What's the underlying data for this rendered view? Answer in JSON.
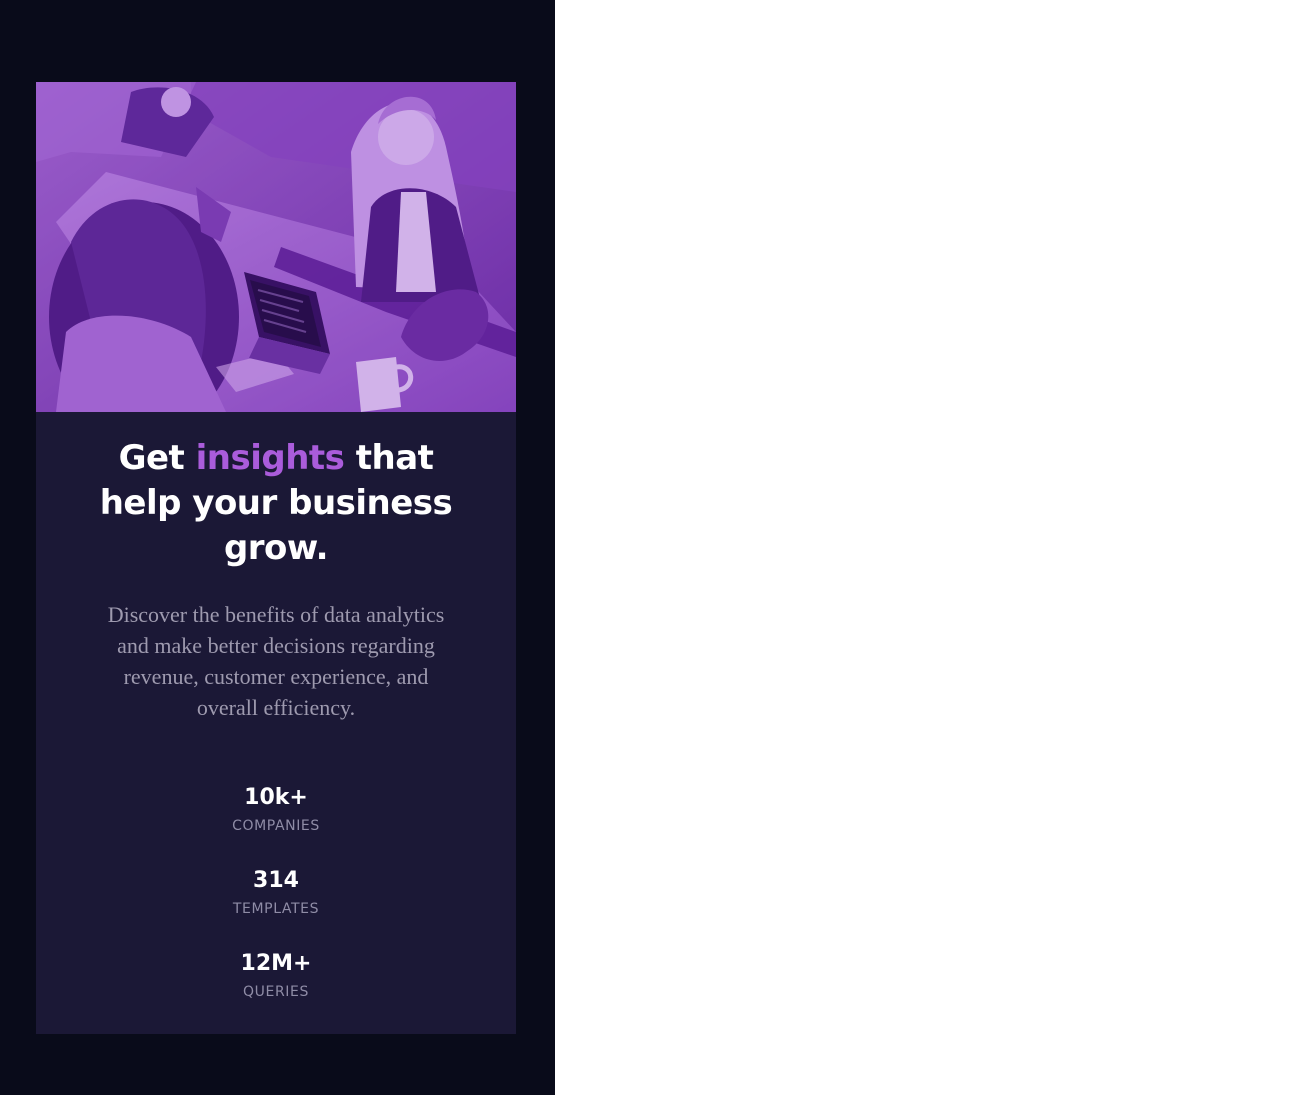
{
  "hero": {
    "image": "office-team-at-laptops-photo"
  },
  "heading": {
    "before": "Get ",
    "accent": "insights",
    "after": " that help your business grow."
  },
  "description": "Discover the benefits of data analytics and make better decisions regarding revenue, customer experience, and overall efficiency.",
  "stats": [
    {
      "value": "10k+",
      "label": "COMPANIES"
    },
    {
      "value": "314",
      "label": "TEMPLATES"
    },
    {
      "value": "12M+",
      "label": "QUERIES"
    }
  ],
  "colors": {
    "page_background": "#090b1a",
    "card_background": "#1b1836",
    "accent": "#aa5cdb",
    "text_primary": "#ffffff",
    "text_secondary": "#9e9aaf"
  }
}
